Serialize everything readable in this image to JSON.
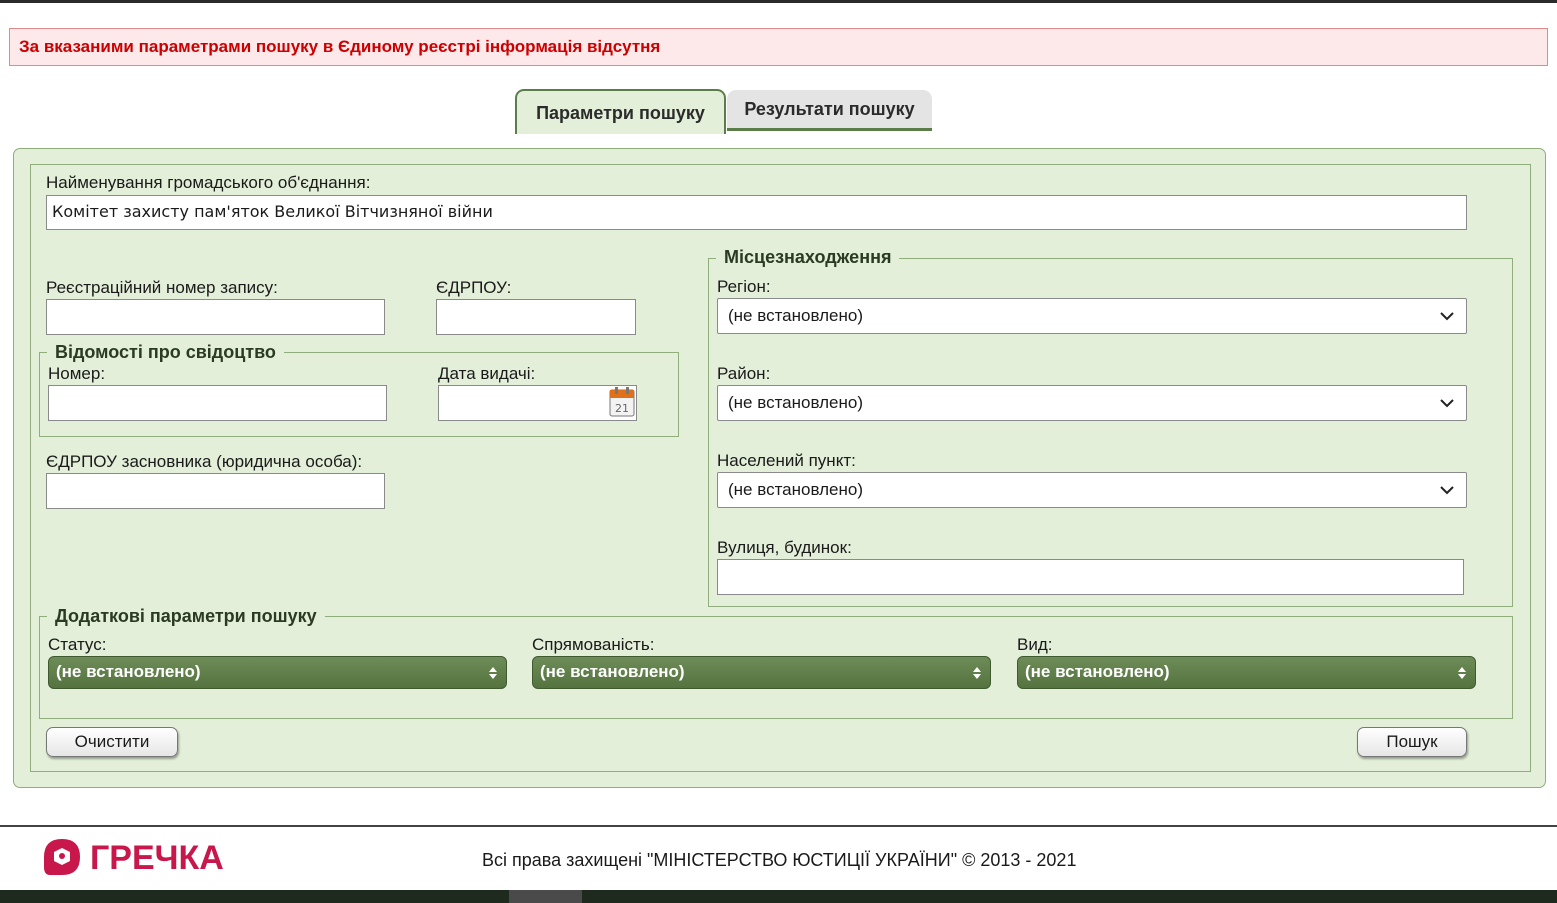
{
  "alert": {
    "message": "За вказаними параметрами пошуку в Єдиному реєстрі інформація відсутня"
  },
  "tabs": [
    {
      "label": "Параметри пошуку",
      "active": true
    },
    {
      "label": "Результати пошуку",
      "active": false
    }
  ],
  "form": {
    "name_label": "Найменування громадського об'єднання:",
    "name_value": "Комітет захисту пам'яток Великої Вітчизняної війни",
    "reg_number_label": "Реєстраційний номер запису:",
    "reg_number_value": "",
    "edrpou_label": "ЄДРПОУ:",
    "edrpou_value": "",
    "certificate": {
      "legend": "Відомості про свідоцтво",
      "number_label": "Номер:",
      "number_value": "",
      "date_label": "Дата видачі:",
      "date_value": "",
      "calendar_icon_text": "21"
    },
    "founder_edrpou_label": "ЄДРПОУ засновника (юридична особа):",
    "founder_edrpou_value": "",
    "location": {
      "legend": "Місцезнаходження",
      "region_label": "Регіон:",
      "region_value": "(не встановлено)",
      "district_label": "Район:",
      "district_value": "(не встановлено)",
      "settlement_label": "Населений пункт:",
      "settlement_value": "(не встановлено)",
      "street_label": "Вулиця, будинок:",
      "street_value": ""
    },
    "additional": {
      "legend": "Додаткові параметри пошуку",
      "status_label": "Статус:",
      "status_value": "(не встановлено)",
      "direction_label": "Спрямованість:",
      "direction_value": "(не встановлено)",
      "type_label": "Вид:",
      "type_value": "(не встановлено)"
    },
    "clear_button": "Очистити",
    "search_button": "Пошук"
  },
  "footer": {
    "logo_text": "ГРЕЧКА",
    "copyright": "Всі права захищені \"МІНІСТЕРСТВО ЮСТИЦІЇ УКРАЇНИ\" © 2013 - 2021"
  },
  "colors": {
    "panel_bg": "#e3efd9",
    "accent_green": "#5b7d4a",
    "alert_text": "#cc0000",
    "logo_color": "#c8174b"
  }
}
